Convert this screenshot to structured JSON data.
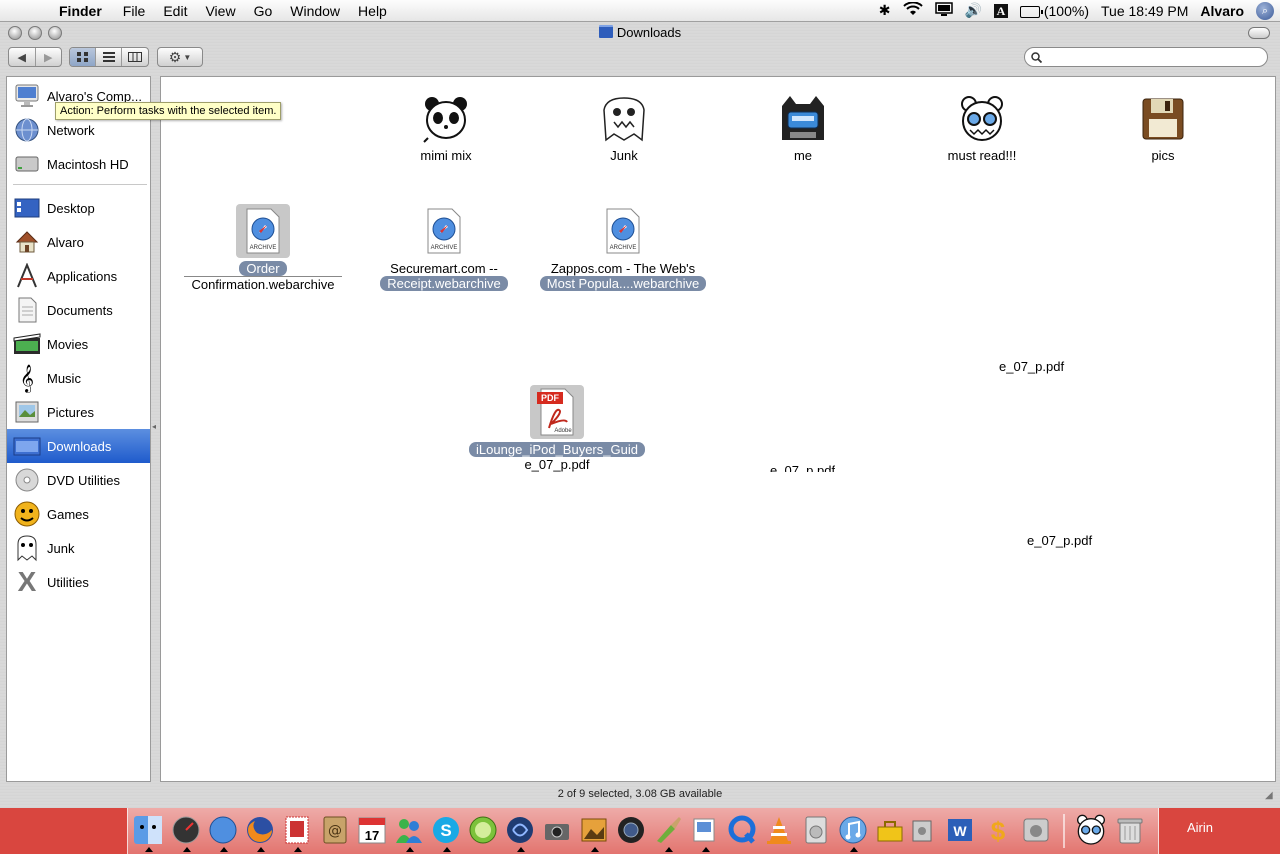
{
  "menubar": {
    "app_name": "Finder",
    "menus": [
      "File",
      "Edit",
      "View",
      "Go",
      "Window",
      "Help"
    ],
    "battery": "(100%)",
    "clock": "Tue 18:49 PM",
    "user": "Alvaro"
  },
  "window": {
    "title": "Downloads",
    "search_placeholder": "",
    "tooltip": "Action: Perform tasks with the selected item.",
    "status": "2 of 9 selected, 3.08 GB available"
  },
  "sidebar": {
    "devices": [
      {
        "label": "Alvaro's Comp...",
        "icon": "imac-icon"
      },
      {
        "label": "Network",
        "icon": "network-globe-icon"
      },
      {
        "label": "Macintosh HD",
        "icon": "hard-drive-icon"
      }
    ],
    "places": [
      {
        "label": "Desktop",
        "icon": "desktop-icon"
      },
      {
        "label": "Alvaro",
        "icon": "home-icon"
      },
      {
        "label": "Applications",
        "icon": "applications-icon"
      },
      {
        "label": "Documents",
        "icon": "documents-icon"
      },
      {
        "label": "Movies",
        "icon": "movies-icon"
      },
      {
        "label": "Music",
        "icon": "music-icon"
      },
      {
        "label": "Pictures",
        "icon": "pictures-icon"
      },
      {
        "label": "Downloads",
        "icon": "downloads-icon",
        "selected": true
      },
      {
        "label": "DVD Utilities",
        "icon": "dvd-icon"
      },
      {
        "label": "Games",
        "icon": "games-icon"
      },
      {
        "label": "Junk",
        "icon": "junk-icon"
      },
      {
        "label": "Utilities",
        "icon": "utilities-icon"
      }
    ]
  },
  "files": {
    "folders": [
      {
        "label": "mimi mix",
        "icon": "panda-icon"
      },
      {
        "label": "Junk",
        "icon": "monster-icon"
      },
      {
        "label": "me",
        "icon": "cat-robot-icon"
      },
      {
        "label": "must read!!!",
        "icon": "radiohead-bear-icon"
      },
      {
        "label": "pics",
        "icon": "floppy-disk-icon"
      }
    ],
    "archives": [
      {
        "line1": "Order",
        "line2": "Confirmation.webarchive",
        "selected": true
      },
      {
        "line1": "Securemart.com --",
        "line2": "Receipt.webarchive",
        "selected": false
      },
      {
        "line1": "Zappos.com - The Web's",
        "line2": "Most Popula....webarchive",
        "selected": false
      }
    ],
    "pdf": {
      "line1": "iLounge_iPod_Buyers_Guid",
      "line2": "e_07_p.pdf",
      "badge_top": "PDF",
      "badge_bottom": "Adobe"
    },
    "ghost_labels": [
      "e_07_p.pdf",
      "e_07_p.pdf",
      "e_07_p.pdf"
    ]
  },
  "dock": {
    "desktop_name": "Airin"
  }
}
